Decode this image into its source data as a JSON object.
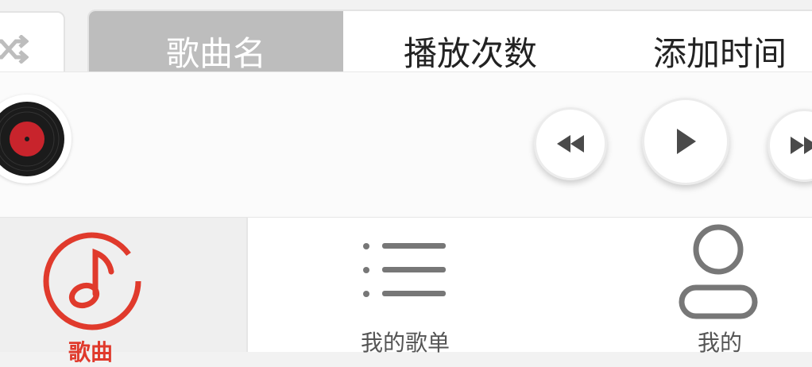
{
  "sort_bar": {
    "shuffle_icon": "shuffle-icon",
    "tabs": [
      {
        "label": "歌曲名",
        "active": true
      },
      {
        "label": "播放次数",
        "active": false
      },
      {
        "label": "添加时间",
        "active": false
      }
    ]
  },
  "player": {
    "album_icon": "vinyl-record-icon",
    "controls": {
      "prev_icon": "rewind-icon",
      "play_icon": "play-icon",
      "next_icon": "fast-forward-icon"
    }
  },
  "bottom_nav": {
    "accent_color": "#e03a2c",
    "items": [
      {
        "label": "歌曲",
        "icon": "music-note-icon",
        "active": true
      },
      {
        "label": "我的歌单",
        "icon": "list-icon",
        "active": false
      },
      {
        "label": "我的",
        "icon": "user-icon",
        "active": false
      }
    ]
  }
}
